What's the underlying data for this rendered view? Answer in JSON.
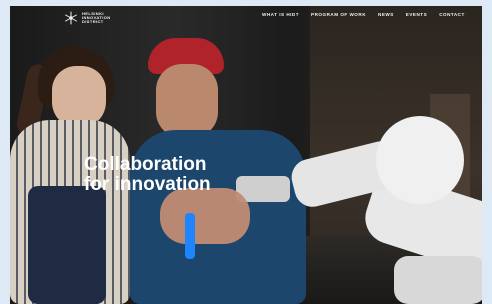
{
  "brand": {
    "lines": [
      "HELSINKI",
      "INNOVATION",
      "DISTRICT"
    ]
  },
  "nav": {
    "items": [
      "WHAT IS HID?",
      "PROGRAM OF WORK",
      "NEWS",
      "EVENTS",
      "CONTACT"
    ]
  },
  "hero": {
    "title_line1": "Collaboration",
    "title_line2": "for innovation"
  },
  "colors": {
    "page_bg": "#dde9f4",
    "text": "#ffffff",
    "beanie": "#b1232b",
    "robot": "#e5e5e5"
  },
  "icons": {
    "logo": "snowflake-logo-icon"
  }
}
